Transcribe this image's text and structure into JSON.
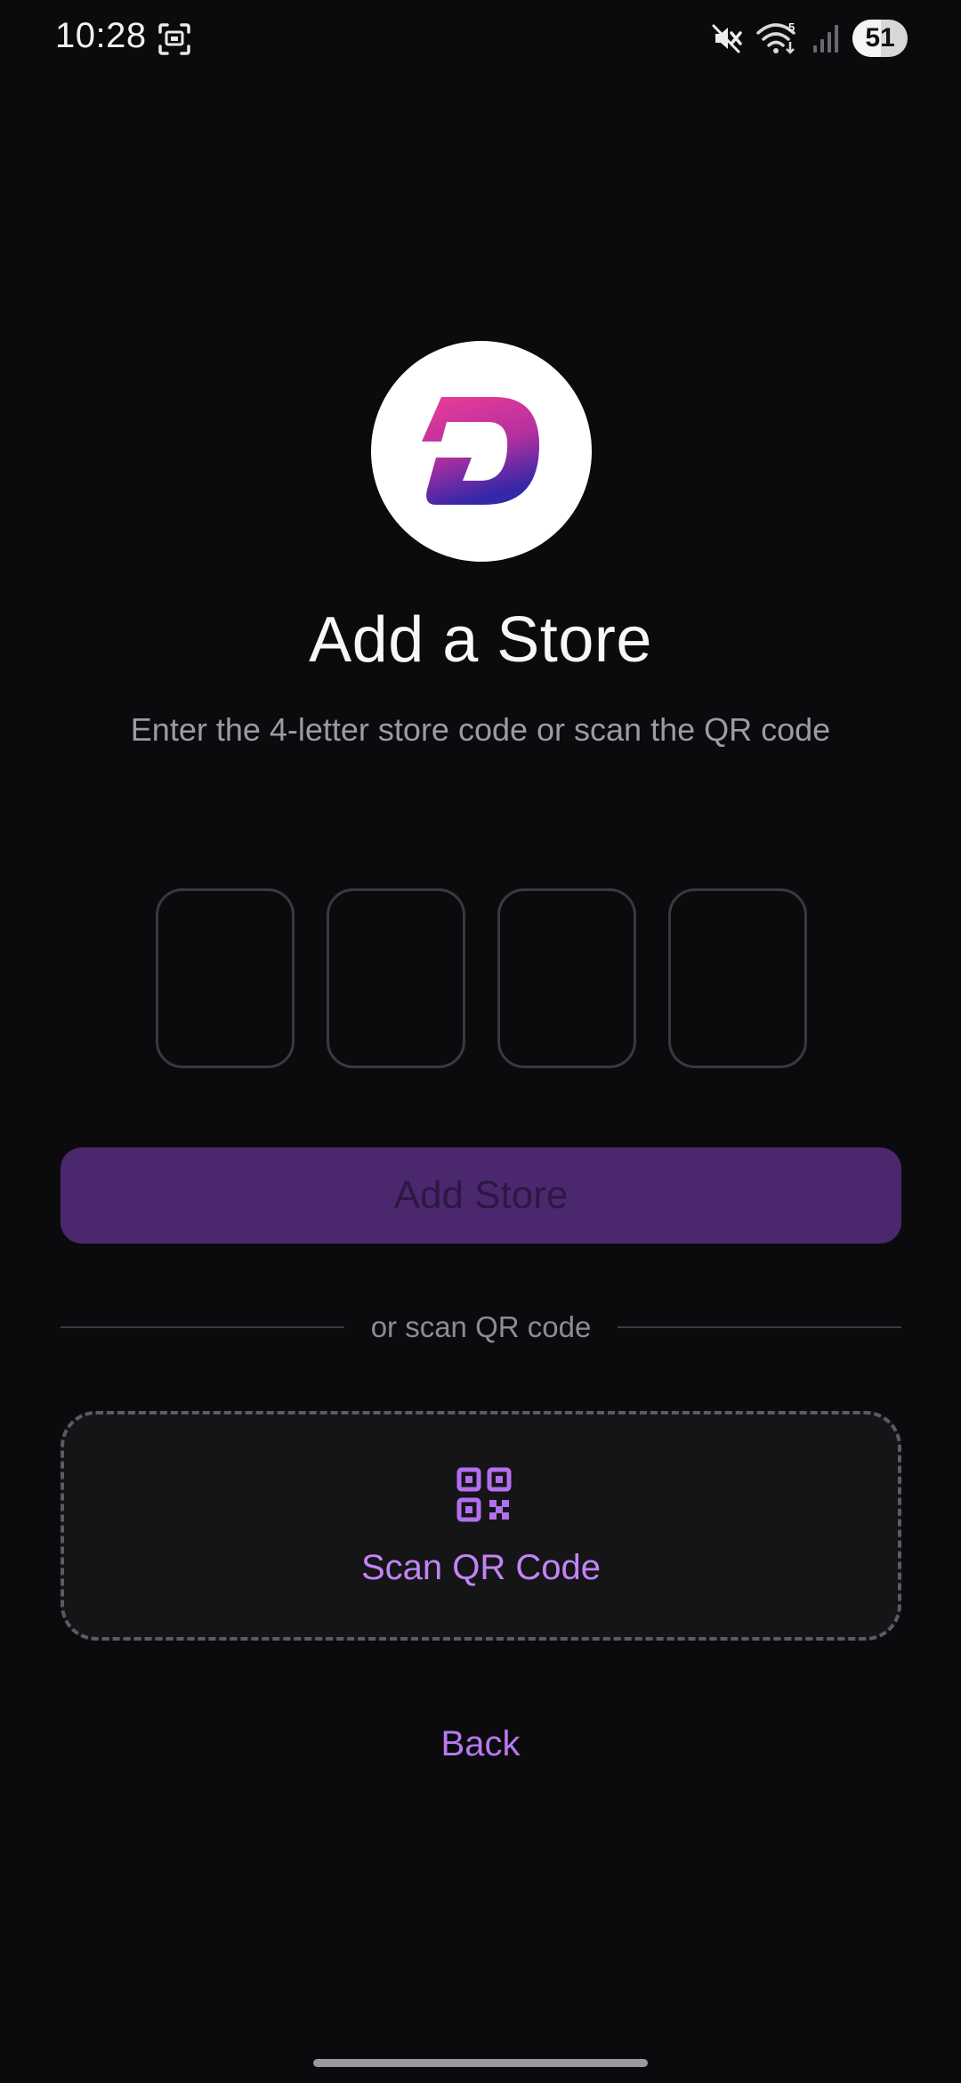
{
  "status_bar": {
    "time": "10:28",
    "battery_level": "51",
    "network_badge": "5"
  },
  "logo": {
    "icon": "d-logo-icon",
    "gradient_top": "#e83e9a",
    "gradient_bottom": "#3b2aa6"
  },
  "header": {
    "title": "Add a Store",
    "subtitle": "Enter the 4-letter store code or scan the QR code"
  },
  "code_input": {
    "boxes": [
      "",
      "",
      "",
      ""
    ]
  },
  "actions": {
    "add_store_label": "Add Store",
    "divider_text": "or scan QR code",
    "scan_label": "Scan QR Code",
    "back_label": "Back"
  },
  "colors": {
    "background": "#0b0b0d",
    "accent": "#c384f5",
    "button_disabled": "#4b286e"
  }
}
